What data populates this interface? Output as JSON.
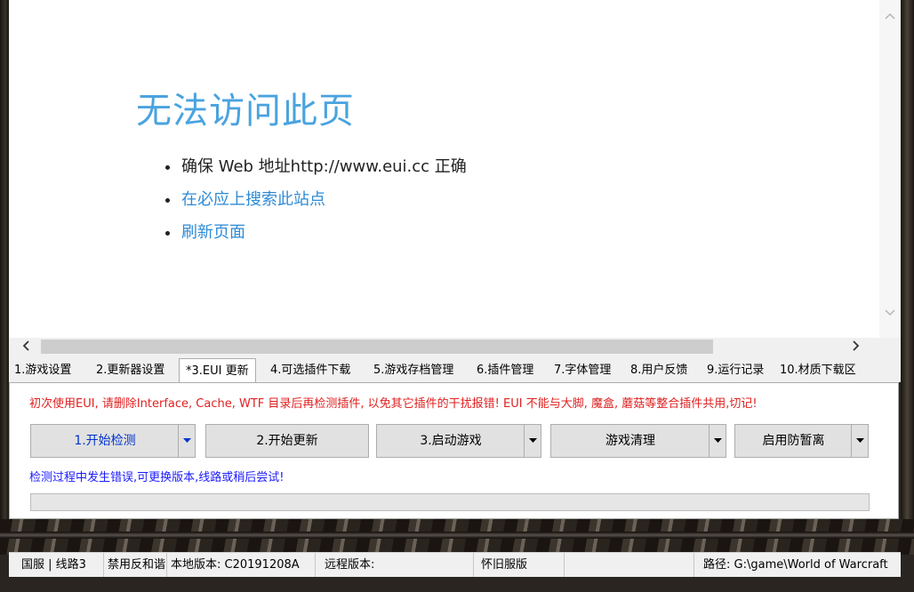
{
  "browser": {
    "error_title": "无法访问此页",
    "error_items": [
      {
        "text": "确保 Web 地址http://www.eui.cc 正确",
        "link": false
      },
      {
        "text": "在必应上搜索此站点",
        "link": true
      },
      {
        "text": "刷新页面",
        "link": true
      }
    ]
  },
  "tabs": [
    {
      "label": "1.游戏设置"
    },
    {
      "label": "2.更新器设置"
    },
    {
      "label": "*3.EUI 更新"
    },
    {
      "label": "4.可选插件下载"
    },
    {
      "label": "5.游戏存档管理"
    },
    {
      "label": "6.插件管理"
    },
    {
      "label": "7.字体管理"
    },
    {
      "label": "8.用户反馈"
    },
    {
      "label": "9.运行记录"
    },
    {
      "label": "10.材质下载区"
    }
  ],
  "active_tab": 2,
  "panel": {
    "warning": "初次使用EUI, 请删除Interface, Cache, WTF 目录后再检测插件, 以免其它插件的干扰报错!  EUI 不能与大脚, 魔盒, 蘑菇等整合插件共用,切记!",
    "buttons": [
      {
        "label": "1.开始检测",
        "dropdown": true
      },
      {
        "label": "2.开始更新",
        "dropdown": false
      },
      {
        "label": "3.启动游戏",
        "dropdown": true
      },
      {
        "label": "游戏清理",
        "dropdown": true
      },
      {
        "label": "启用防暂离",
        "dropdown": true
      }
    ],
    "info": "检测过程中发生错误,可更换版本,线路或稍后尝试!",
    "progress": 0
  },
  "status": {
    "region_line": "国服 | 线路3",
    "anti_harmony": "禁用反和谐",
    "local_version": "本地版本: C20191208A",
    "remote_version": "远程版本:",
    "server_type": "怀旧服版",
    "empty": "",
    "path": "路径: G:\\game\\World of Warcraft"
  },
  "colors": {
    "warning_text": "#e02020",
    "info_text": "#1a1aff",
    "error_title": "#4aa3df",
    "link": "#2e8bd6",
    "dropdown_arrow_blue": "#0033cc"
  },
  "icons": {
    "scroll_up": "chevron-up-icon",
    "scroll_down": "chevron-down-icon",
    "scroll_left": "chevron-left-icon",
    "scroll_right": "chevron-right-icon",
    "dropdown": "caret-down-icon"
  }
}
